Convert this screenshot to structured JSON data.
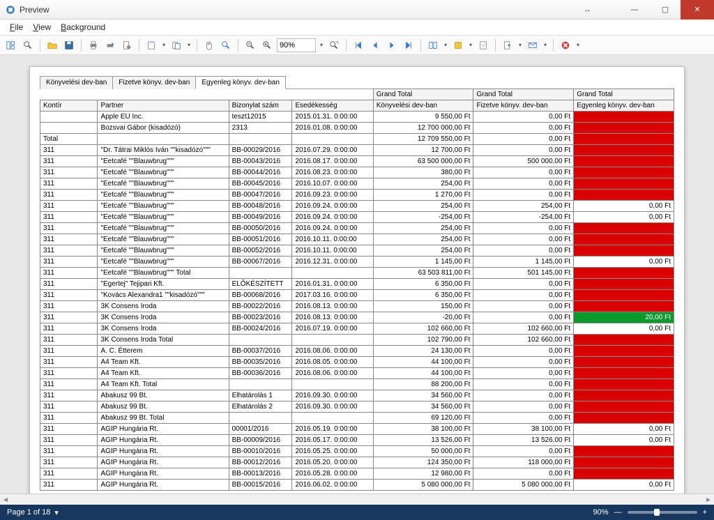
{
  "window": {
    "title": "Preview"
  },
  "menu": {
    "file": "File",
    "view": "View",
    "background": "Background"
  },
  "toolbar": {
    "zoom_value": "90%"
  },
  "tabs": [
    {
      "label": "Könyvelési dev-ban",
      "active": false
    },
    {
      "label": "Fizetve könyv. dev-ban",
      "active": false
    },
    {
      "label": "Egyenleg könyv. dev-ban",
      "active": true
    }
  ],
  "grand_total_header": "Grand Total",
  "columns": {
    "kontir": "Kontír",
    "partner": "Partner",
    "biz": "Bizonylat szám",
    "esed": "Esedékesség",
    "konyv": "Könyvelési dev-ban",
    "fizetve": "Fizetve könyv. dev-ban",
    "egyenleg": "Egyenleg könyv. dev-ban"
  },
  "rows": [
    {
      "k": "",
      "p": "Apple EU Inc.",
      "b": "teszt12015",
      "e": "2015.01.31. 0:00:00",
      "v1": "9 550,00 Ft",
      "v2": "0,00 Ft",
      "v3": "",
      "s": "red"
    },
    {
      "k": "",
      "p": "Bozsvai Gábor (kisadózó)",
      "b": "2313",
      "e": "2016.01.08. 0:00:00",
      "v1": "12 700 000,00 Ft",
      "v2": "0,00 Ft",
      "v3": "",
      "s": "red"
    },
    {
      "k": "Total",
      "p": "",
      "b": "",
      "e": "",
      "v1": "12 709 550,00 Ft",
      "v2": "0,00 Ft",
      "v3": "",
      "s": "red",
      "total": true
    },
    {
      "k": "311",
      "p": "\"Dr. Tátrai Miklós Iván \"\"kisadózó\"\"\"",
      "b": "BB-00029/2016",
      "e": "2016.07.29. 0:00:00",
      "v1": "12 700,00 Ft",
      "v2": "0,00 Ft",
      "v3": "",
      "s": "red"
    },
    {
      "k": "311",
      "p": "\"Eetcafé \"\"Blauwbrug\"\"\"",
      "b": "BB-00043/2016",
      "e": "2016.08.17. 0:00:00",
      "v1": "63 500 000,00 Ft",
      "v2": "500 000,00 Ft",
      "v3": "",
      "s": "red"
    },
    {
      "k": "311",
      "p": "\"Eetcafé \"\"Blauwbrug\"\"\"",
      "b": "BB-00044/2016",
      "e": "2016.08.23. 0:00:00",
      "v1": "380,00 Ft",
      "v2": "0,00 Ft",
      "v3": "",
      "s": "red"
    },
    {
      "k": "311",
      "p": "\"Eetcafé \"\"Blauwbrug\"\"\"",
      "b": "BB-00045/2016",
      "e": "2016.10.07. 0:00:00",
      "v1": "254,00 Ft",
      "v2": "0,00 Ft",
      "v3": "",
      "s": "red"
    },
    {
      "k": "311",
      "p": "\"Eetcafé \"\"Blauwbrug\"\"\"",
      "b": "BB-00047/2016",
      "e": "2016.09.23. 0:00:00",
      "v1": "1 270,00 Ft",
      "v2": "0,00 Ft",
      "v3": "",
      "s": "red"
    },
    {
      "k": "311",
      "p": "\"Eetcafé \"\"Blauwbrug\"\"\"",
      "b": "BB-00048/2016",
      "e": "2016.09.24. 0:00:00",
      "v1": "254,00 Ft",
      "v2": "254,00 Ft",
      "v3": "0,00 Ft",
      "s": "white"
    },
    {
      "k": "311",
      "p": "\"Eetcafé \"\"Blauwbrug\"\"\"",
      "b": "BB-00049/2016",
      "e": "2016.09.24. 0:00:00",
      "v1": "-254,00 Ft",
      "v2": "-254,00 Ft",
      "v3": "0,00 Ft",
      "s": "white"
    },
    {
      "k": "311",
      "p": "\"Eetcafé \"\"Blauwbrug\"\"\"",
      "b": "BB-00050/2016",
      "e": "2016.09.24. 0:00:00",
      "v1": "254,00 Ft",
      "v2": "0,00 Ft",
      "v3": "",
      "s": "red"
    },
    {
      "k": "311",
      "p": "\"Eetcafé \"\"Blauwbrug\"\"\"",
      "b": "BB-00051/2016",
      "e": "2016.10.11. 0:00:00",
      "v1": "254,00 Ft",
      "v2": "0,00 Ft",
      "v3": "",
      "s": "red"
    },
    {
      "k": "311",
      "p": "\"Eetcafé \"\"Blauwbrug\"\"\"",
      "b": "BB-00052/2016",
      "e": "2016.10.11. 0:00:00",
      "v1": "254,00 Ft",
      "v2": "0,00 Ft",
      "v3": "",
      "s": "red"
    },
    {
      "k": "311",
      "p": "\"Eetcafé \"\"Blauwbrug\"\"\"",
      "b": "BB-00067/2016",
      "e": "2016.12.31. 0:00:00",
      "v1": "1 145,00 Ft",
      "v2": "1 145,00 Ft",
      "v3": "0,00 Ft",
      "s": "white"
    },
    {
      "k": "311",
      "p": "\"Eetcafé \"\"Blauwbrug\"\"\" Total",
      "b": "",
      "e": "",
      "v1": "63 503 811,00 Ft",
      "v2": "501 145,00 Ft",
      "v3": "",
      "s": "red",
      "total": true
    },
    {
      "k": "311",
      "p": "\"Egertej\" Tejipari Kft.",
      "b": "ELŐKÉSZÍTETT",
      "e": "2016.01.31. 0:00:00",
      "v1": "6 350,00 Ft",
      "v2": "0,00 Ft",
      "v3": "",
      "s": "red"
    },
    {
      "k": "311",
      "p": "\"Kovács Alexandra1 \"\"kisadózó\"\"\"",
      "b": "BB-00068/2016",
      "e": "2017.03.16. 0:00:00",
      "v1": "6 350,00 Ft",
      "v2": "0,00 Ft",
      "v3": "",
      "s": "red"
    },
    {
      "k": "311",
      "p": "3K Consens Iroda",
      "b": "BB-00022/2016",
      "e": "2016.08.13. 0:00:00",
      "v1": "150,00 Ft",
      "v2": "0,00 Ft",
      "v3": "",
      "s": "red"
    },
    {
      "k": "311",
      "p": "3K Consens Iroda",
      "b": "BB-00023/2016",
      "e": "2016.08.13. 0:00:00",
      "v1": "-20,00 Ft",
      "v2": "0,00 Ft",
      "v3": "20,00 Ft",
      "s": "green"
    },
    {
      "k": "311",
      "p": "3K Consens Iroda",
      "b": "BB-00024/2016",
      "e": "2016.07.19. 0:00:00",
      "v1": "102 660,00 Ft",
      "v2": "102 660,00 Ft",
      "v3": "0,00 Ft",
      "s": "white"
    },
    {
      "k": "311",
      "p": "3K Consens Iroda Total",
      "b": "",
      "e": "",
      "v1": "102 790,00 Ft",
      "v2": "102 660,00 Ft",
      "v3": "",
      "s": "red",
      "total": true
    },
    {
      "k": "311",
      "p": "A. C. Étterem",
      "b": "BB-00037/2016",
      "e": "2016.08.06. 0:00:00",
      "v1": "24 130,00 Ft",
      "v2": "0,00 Ft",
      "v3": "",
      "s": "red"
    },
    {
      "k": "311",
      "p": "A4 Team Kft.",
      "b": "BB-00035/2016",
      "e": "2016.08.05. 0:00:00",
      "v1": "44 100,00 Ft",
      "v2": "0,00 Ft",
      "v3": "",
      "s": "red"
    },
    {
      "k": "311",
      "p": "A4 Team Kft.",
      "b": "BB-00036/2016",
      "e": "2016.08.06. 0:00:00",
      "v1": "44 100,00 Ft",
      "v2": "0,00 Ft",
      "v3": "",
      "s": "red"
    },
    {
      "k": "311",
      "p": "A4 Team Kft. Total",
      "b": "",
      "e": "",
      "v1": "88 200,00 Ft",
      "v2": "0,00 Ft",
      "v3": "",
      "s": "red",
      "total": true
    },
    {
      "k": "311",
      "p": "Abakusz 99 Bt.",
      "b": "Elhatárolás 1",
      "e": "2016.09.30. 0:00:00",
      "v1": "34 560,00 Ft",
      "v2": "0,00 Ft",
      "v3": "",
      "s": "red"
    },
    {
      "k": "311",
      "p": "Abakusz 99 Bt.",
      "b": "Elhatárolás 2",
      "e": "2016.09.30. 0:00:00",
      "v1": "34 560,00 Ft",
      "v2": "0,00 Ft",
      "v3": "",
      "s": "red"
    },
    {
      "k": "311",
      "p": "Abakusz 99 Bt. Total",
      "b": "",
      "e": "",
      "v1": "69 120,00 Ft",
      "v2": "0,00 Ft",
      "v3": "",
      "s": "red",
      "total": true
    },
    {
      "k": "311",
      "p": "AGIP Hungária Rt.",
      "b": "00001/2016",
      "e": "2016.05.19. 0:00:00",
      "v1": "38 100,00 Ft",
      "v2": "38 100,00 Ft",
      "v3": "0,00 Ft",
      "s": "white"
    },
    {
      "k": "311",
      "p": "AGIP Hungária Rt.",
      "b": "BB-00009/2016",
      "e": "2016.05.17. 0:00:00",
      "v1": "13 526,00 Ft",
      "v2": "13 526,00 Ft",
      "v3": "0,00 Ft",
      "s": "white"
    },
    {
      "k": "311",
      "p": "AGIP Hungária Rt.",
      "b": "BB-00010/2016",
      "e": "2016.05.25. 0:00:00",
      "v1": "50 000,00 Ft",
      "v2": "0,00 Ft",
      "v3": "",
      "s": "red"
    },
    {
      "k": "311",
      "p": "AGIP Hungária Rt.",
      "b": "BB-00012/2016",
      "e": "2016.05.20. 0:00:00",
      "v1": "124 350,00 Ft",
      "v2": "118 000,00 Ft",
      "v3": "",
      "s": "red"
    },
    {
      "k": "311",
      "p": "AGIP Hungária Rt.",
      "b": "BB-00013/2016",
      "e": "2016.05.28. 0:00:00",
      "v1": "12 980,00 Ft",
      "v2": "0,00 Ft",
      "v3": "",
      "s": "red"
    },
    {
      "k": "311",
      "p": "AGIP Hungária Rt.",
      "b": "BB-00015/2016",
      "e": "2016.06.02. 0:00:00",
      "v1": "5 080 000,00 Ft",
      "v2": "5 080 000,00 Ft",
      "v3": "0,00 Ft",
      "s": "white"
    }
  ],
  "status": {
    "page_label": "Page 1 of 18",
    "zoom": "90%"
  }
}
